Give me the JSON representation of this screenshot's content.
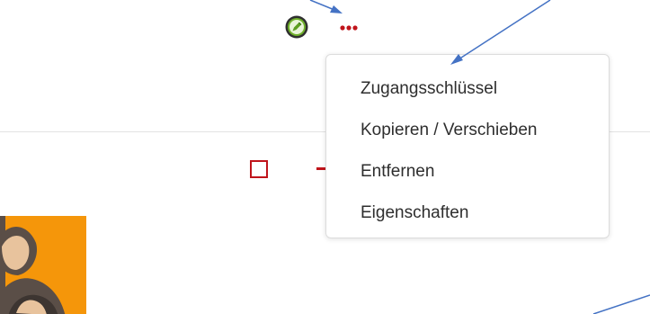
{
  "header": {
    "edit_icon": "pencil-edit-icon",
    "more_icon": "more-horizontal-dots-icon"
  },
  "context_menu": {
    "items": [
      {
        "label": "Zugangsschlüssel"
      },
      {
        "label": "Kopieren / Verschieben"
      },
      {
        "label": "Entfernen"
      },
      {
        "label": "Eigenschaften"
      }
    ]
  },
  "colors": {
    "accent_red": "#c0141b",
    "edit_icon_green": "#5c9e1f",
    "avatar_background": "#f5960a",
    "annotation_arrow": "#4472c4",
    "menu_text": "#2e2e2e"
  }
}
